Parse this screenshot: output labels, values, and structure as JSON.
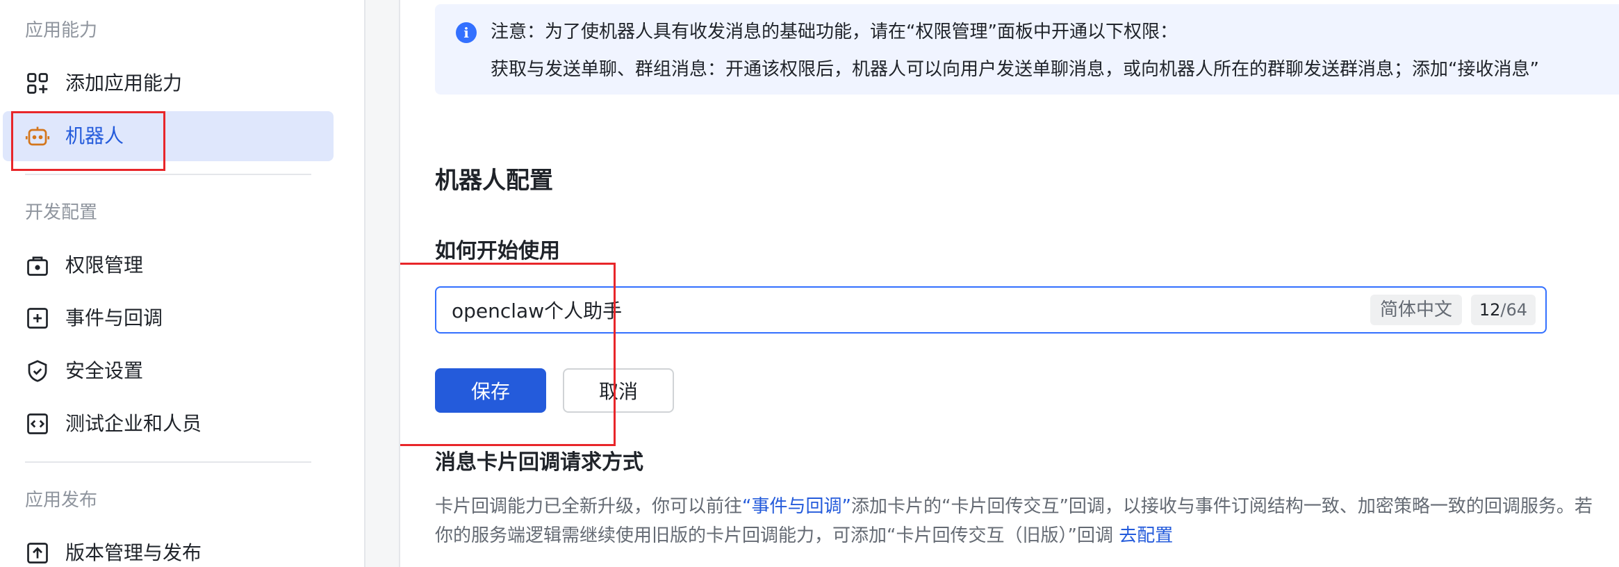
{
  "sidebar": {
    "sections": [
      {
        "title": "应用能力"
      },
      {
        "title": "开发配置"
      },
      {
        "title": "应用发布"
      }
    ],
    "items": [
      {
        "label": "添加应用能力",
        "icon": "apps-add-icon"
      },
      {
        "label": "机器人",
        "icon": "robot-icon",
        "active": true
      },
      {
        "label": "权限管理",
        "icon": "permission-lock-icon"
      },
      {
        "label": "事件与回调",
        "icon": "event-plus-icon"
      },
      {
        "label": "安全设置",
        "icon": "shield-check-icon"
      },
      {
        "label": "测试企业和人员",
        "icon": "test-code-icon"
      },
      {
        "label": "版本管理与发布",
        "icon": "upload-version-icon"
      }
    ]
  },
  "notice": {
    "title": "注意：为了使机器人具有收发消息的基础功能，请在“权限管理”面板中开通以下权限：",
    "body": "获取与发送单聊、群组消息：开通该权限后，机器人可以向用户发送单聊消息，或向机器人所在的群聊发送群消息；添加“接收消息”"
  },
  "main": {
    "config_heading": "机器人配置",
    "howto_heading": "如何开始使用",
    "input": {
      "value": "openclaw个人助手",
      "language": "简体中文",
      "count": "12",
      "max": "/64"
    },
    "save_label": "保存",
    "cancel_label": "取消",
    "card_heading": "消息卡片回调请求方式",
    "card_desc": {
      "part1": "卡片回调能力已全新升级，你可以前往",
      "link1": "“事件与回调”",
      "part2": "添加卡片的“卡片回传交互”回调，以接收与事件订阅结构一致、加密策略一致的回调服务。若你的服务端逻辑需继续使用旧版的卡片回调能力，可添加“卡片回传交互（旧版）”回调 ",
      "link2": "去配置"
    }
  },
  "colors": {
    "accent": "#245bdb",
    "active_bg": "#dfe7fc",
    "highlight": "#e8262a",
    "robot_icon": "#d4761c"
  }
}
